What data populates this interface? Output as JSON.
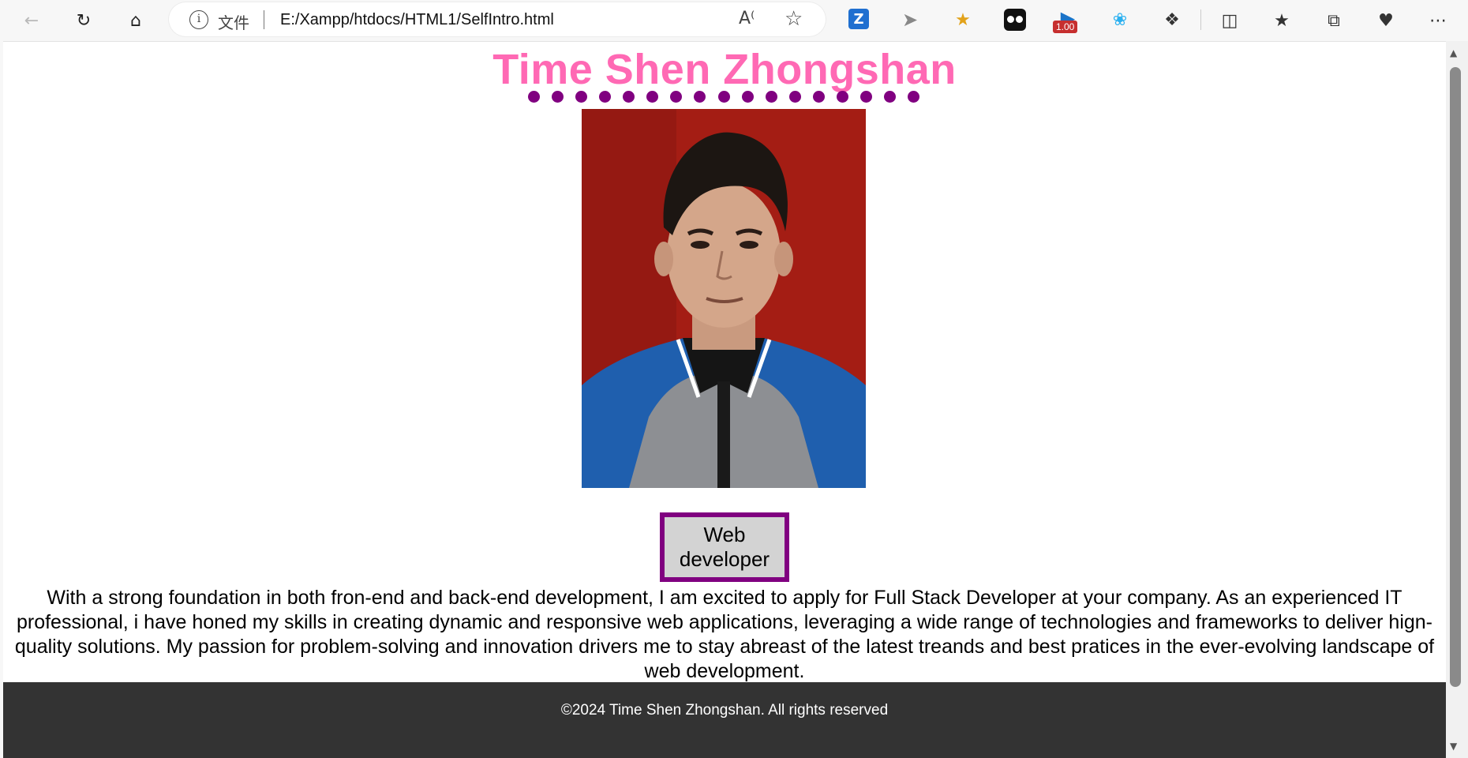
{
  "browser": {
    "scheme_label": "文件",
    "url": "E:/Xampp/htdocs/HTML1/SelfIntro.html",
    "extension_badge": "1.00",
    "icons": [
      "back-icon",
      "refresh-icon",
      "home-icon",
      "info-icon",
      "read-aloud-icon",
      "favorite-star-icon",
      "split-screen-icon",
      "favorites-icon",
      "collections-icon",
      "browser-essentials-icon",
      "more-icon"
    ]
  },
  "page": {
    "name": "Time Shen Zhongshan",
    "role_line1": "Web",
    "role_line2": "developer",
    "intro": "With a strong foundation in both fron-end and back-end development, I am excited to apply for Full Stack Developer at your company. As an experienced IT professional, i have honed my skills in creating dynamic and responsive web applications, leveraging a wide range of technologies and frameworks to deliver hign-quality solutions. My passion for problem-solving and innovation drivers me to stay abreast of the latest treands and best pratices in the ever-evolving landscape of web development.",
    "footer": "©2024 Time Shen Zhongshan. All rights reserved"
  },
  "colors": {
    "name": "#ff69b4",
    "dots": "#800080",
    "role_border": "#800080",
    "role_bg": "#d3d3d3",
    "footer_bg": "#333333",
    "photo_bg": "#a41d14"
  }
}
